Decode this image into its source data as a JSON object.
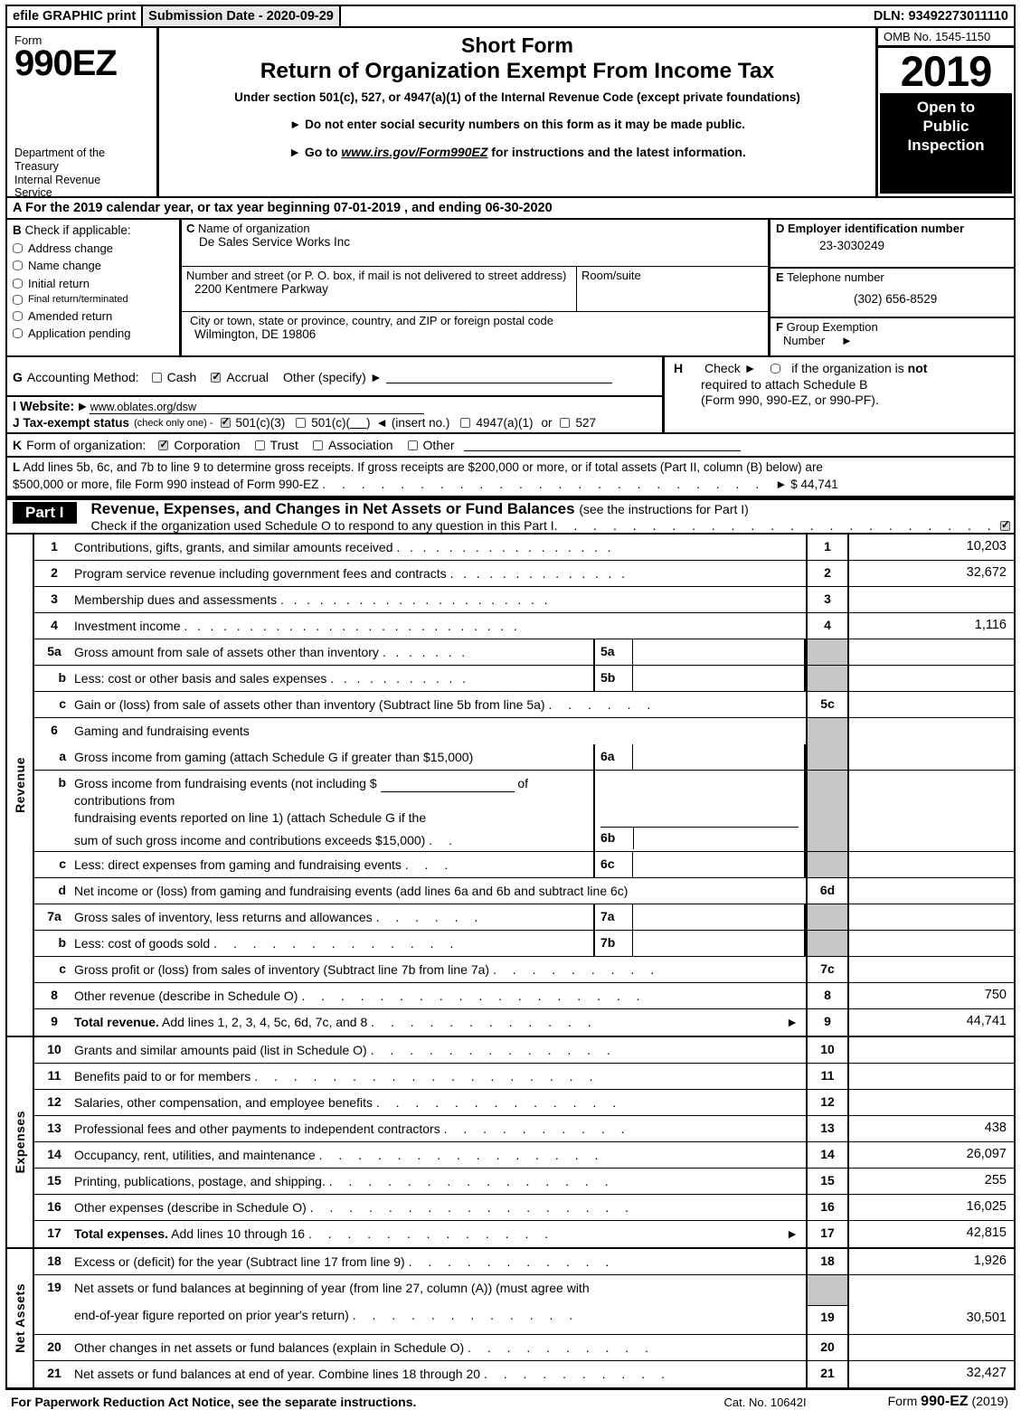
{
  "efile": {
    "left_label": "efile GRAPHIC print",
    "submission_date": "Submission Date - 2020-09-29",
    "dln": "DLN: 93492273011110"
  },
  "header": {
    "form_label": "Form",
    "form_number": "990EZ",
    "department": "Department of the Treasury Internal Revenue Service",
    "title_short": "Short Form",
    "title_main": "Return of Organization Exempt From Income Tax",
    "subtitle": "Under section 501(c), 527, or 4947(a)(1) of the Internal Revenue Code (except private foundations)",
    "bullet1": "Do not enter social security numbers on this form as it may be made public.",
    "bullet2_prefix": "Go to",
    "bullet2_link": "www.irs.gov/Form990EZ",
    "bullet2_suffix": "for instructions and the latest information.",
    "omb": "OMB No. 1545-1150",
    "year": "2019",
    "open_to_public": "Open to Public Inspection"
  },
  "line_a": {
    "letter": "A",
    "text": "For the 2019 calendar year, or tax year beginning 07-01-2019 , and ending 06-30-2020"
  },
  "box_b": {
    "letter": "B",
    "title": "Check if applicable:",
    "items": [
      {
        "label": "Address change",
        "checked": false
      },
      {
        "label": "Name change",
        "checked": false
      },
      {
        "label": "Initial return",
        "checked": false
      },
      {
        "label": "Final return/terminated",
        "checked": false
      },
      {
        "label": "Amended return",
        "checked": false
      },
      {
        "label": "Application pending",
        "checked": false
      }
    ]
  },
  "box_c": {
    "letter": "C",
    "name_label": "Name of organization",
    "name_value": "De Sales Service Works Inc",
    "street_label": "Number and street (or P. O. box, if mail is not delivered to street address)",
    "street_value": "2200 Kentmere Parkway",
    "room_label": "Room/suite",
    "room_value": "",
    "city_label": "City or town, state or province, country, and ZIP or foreign postal code",
    "city_value": "Wilmington, DE   19806"
  },
  "box_d": {
    "letter": "D",
    "ein_label": "Employer identification number",
    "ein_value": "23-3030249",
    "phone_letter": "E",
    "phone_label": "Telephone number",
    "phone_value": "(302) 656-8529",
    "group_letter": "F",
    "group_label_line1": "Group Exemption",
    "group_label_line2": "Number",
    "group_value": ""
  },
  "line_g": {
    "letter": "G",
    "label": "Accounting Method:",
    "cash": "Cash",
    "cash_checked": false,
    "accrual": "Accrual",
    "accrual_checked": true,
    "other": "Other (specify)",
    "other_value": ""
  },
  "line_h": {
    "letter": "H",
    "line1a": "Check",
    "line1b": "if the organization is",
    "line1c": "not",
    "line2": "required to attach Schedule B",
    "line3": "(Form 990, 990-EZ, or 990-PF).",
    "checked": false
  },
  "line_i": {
    "letter": "I",
    "label": "Website:",
    "value": "www.oblates.org/dsw"
  },
  "line_j": {
    "letter": "J",
    "label": "Tax-exempt status",
    "note": "(check only one) -",
    "opt1": "501(c)(3)",
    "opt1_checked": true,
    "opt2": "501(c)(",
    "opt2_suffix": ")",
    "opt2_checked": false,
    "insert": "(insert no.)",
    "opt3": "4947(a)(1)",
    "opt3_checked": false,
    "or": "or",
    "opt4": "527",
    "opt4_checked": false
  },
  "line_k": {
    "letter": "K",
    "label": "Form of organization:",
    "options": [
      {
        "label": "Corporation",
        "checked": true
      },
      {
        "label": "Trust",
        "checked": false
      },
      {
        "label": "Association",
        "checked": false
      },
      {
        "label": "Other",
        "checked": false
      }
    ],
    "other_value": ""
  },
  "line_l": {
    "letter": "L",
    "text_line1": "Add lines 5b, 6c, and 7b to line 9 to determine gross receipts. If gross receipts are $200,000 or more, or if total assets (Part II, column (B) below) are",
    "text_line2": "$500,000 or more, file Form 990 instead of Form 990-EZ",
    "amount": "$ 44,741"
  },
  "part1": {
    "tag": "Part I",
    "title": "Revenue, Expenses, and Changes in Net Assets or Fund Balances",
    "title_note": "(see the instructions for Part I)",
    "subtitle": "Check if the organization used Schedule O to respond to any question in this Part I",
    "sched_o_checked": true
  },
  "revenue": {
    "section_label": "Revenue",
    "rows": [
      {
        "num": "1",
        "text": "Contributions, gifts, grants, and similar amounts received",
        "dots": true,
        "line": "1",
        "value": "10,203"
      },
      {
        "num": "2",
        "text": "Program service revenue including government fees and contracts",
        "dots": true,
        "line": "2",
        "value": "32,672"
      },
      {
        "num": "3",
        "text": "Membership dues and assessments",
        "dots": true,
        "line": "3",
        "value": ""
      },
      {
        "num": "4",
        "text": "Investment income",
        "dots": true,
        "line": "4",
        "value": "1,116"
      },
      {
        "num": "5a",
        "text": "Gross amount from sale of assets other than inventory",
        "sub_num": "5a",
        "sub_value": "",
        "line": "",
        "value": "",
        "shaded": true
      },
      {
        "num": "b",
        "indent": true,
        "text": "Less: cost or other basis and sales expenses",
        "sub_num": "5b",
        "sub_value": "",
        "line": "",
        "value": "",
        "shaded": true
      },
      {
        "num": "c",
        "indent": true,
        "text": "Gain or (loss) from sale of assets other than inventory (Subtract line 5b from line 5a)",
        "dots": true,
        "line": "5c",
        "value": ""
      },
      {
        "num": "6",
        "text": "Gaming and fundraising events",
        "line": "",
        "value": "",
        "shaded": true
      },
      {
        "num": "a",
        "indent": true,
        "text": "Gross income from gaming (attach Schedule G if greater than $15,000)",
        "sub_num": "6a",
        "sub_value": "",
        "line": "",
        "value": "",
        "shaded": true
      },
      {
        "num": "b",
        "indent": true,
        "text": "Gross income from fundraising events (not including $ ____________ of contributions from fundraising events reported on line 1) (attach Schedule G if the sum of such gross income and contributions exceeds $15,000)",
        "multiline": true,
        "sub_num": "6b",
        "sub_value": "",
        "line": "",
        "value": "",
        "shaded": true
      },
      {
        "num": "c",
        "indent": true,
        "text": "Less: direct expenses from gaming and fundraising events",
        "sub_num": "6c",
        "sub_value": "",
        "line": "",
        "value": "",
        "shaded": true
      },
      {
        "num": "d",
        "indent": true,
        "text": "Net income or (loss) from gaming and fundraising events (add lines 6a and 6b and subtract line 6c)",
        "line": "6d",
        "value": ""
      },
      {
        "num": "7a",
        "text": "Gross sales of inventory, less returns and allowances",
        "sub_num": "7a",
        "sub_value": "",
        "line": "",
        "value": "",
        "shaded": true
      },
      {
        "num": "b",
        "indent": true,
        "text": "Less: cost of goods sold",
        "sub_num": "7b",
        "sub_value": "",
        "line": "",
        "value": "",
        "shaded": true
      },
      {
        "num": "c",
        "indent": true,
        "text": "Gross profit or (loss) from sales of inventory (Subtract line 7b from line 7a)",
        "dots": true,
        "line": "7c",
        "value": ""
      },
      {
        "num": "8",
        "text": "Other revenue (describe in Schedule O)",
        "dots": true,
        "line": "8",
        "value": "750"
      },
      {
        "num": "9",
        "text": "Total revenue.",
        "text2": " Add lines 1, 2, 3, 4, 5c, 6d, 7c, and 8",
        "bold_lead": true,
        "dots": true,
        "arrow": true,
        "line": "9",
        "value": "44,741"
      }
    ]
  },
  "expenses": {
    "section_label": "Expenses",
    "rows": [
      {
        "num": "10",
        "text": "Grants and similar amounts paid (list in Schedule O)",
        "dots": true,
        "line": "10",
        "value": ""
      },
      {
        "num": "11",
        "text": "Benefits paid to or for members",
        "dots": true,
        "line": "11",
        "value": ""
      },
      {
        "num": "12",
        "text": "Salaries, other compensation, and employee benefits",
        "dots": true,
        "line": "12",
        "value": ""
      },
      {
        "num": "13",
        "text": "Professional fees and other payments to independent contractors",
        "dots": true,
        "line": "13",
        "value": "438"
      },
      {
        "num": "14",
        "text": "Occupancy, rent, utilities, and maintenance",
        "dots": true,
        "line": "14",
        "value": "26,097"
      },
      {
        "num": "15",
        "text": "Printing, publications, postage, and shipping.",
        "dots": true,
        "line": "15",
        "value": "255"
      },
      {
        "num": "16",
        "text": "Other expenses (describe in Schedule O)",
        "dots": true,
        "line": "16",
        "value": "16,025"
      },
      {
        "num": "17",
        "text": "Total expenses.",
        "text2": " Add lines 10 through 16",
        "bold_lead": true,
        "dots": true,
        "arrow": true,
        "line": "17",
        "value": "42,815"
      }
    ]
  },
  "net_assets": {
    "section_label": "Net Assets",
    "rows": [
      {
        "num": "18",
        "text": "Excess or (deficit) for the year (Subtract line 17 from line 9)",
        "dots": true,
        "line": "18",
        "value": "1,926"
      },
      {
        "num": "19",
        "text": "Net assets or fund balances at beginning of year (from line 27, column (A)) (must agree with end-of-year figure reported on prior year's return)",
        "multiline": true,
        "dots": true,
        "line": "19",
        "value": "30,501"
      },
      {
        "num": "20",
        "text": "Other changes in net assets or fund balances (explain in Schedule O)",
        "dots": true,
        "line": "20",
        "value": ""
      },
      {
        "num": "21",
        "text": "Net assets or fund balances at end of year. Combine lines 18 through 20",
        "dots": true,
        "line": "21",
        "value": "32,427"
      }
    ]
  },
  "footer": {
    "notice": "For Paperwork Reduction Act Notice, see the separate instructions.",
    "cat": "Cat. No. 10642I",
    "form_prefix": "Form",
    "form_name": "990-EZ",
    "form_year": "(2019)"
  }
}
